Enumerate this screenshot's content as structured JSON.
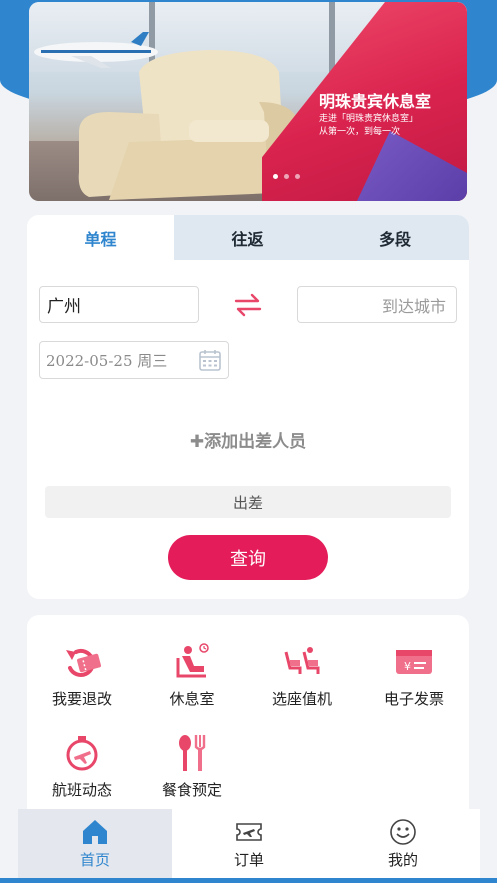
{
  "banner": {
    "title": "明珠贵宾休息室",
    "subtitle_line1": "走进「明珠贵宾休息室」",
    "subtitle_line2": "从第一次，到每一次"
  },
  "booking": {
    "tabs": [
      {
        "label": "单程",
        "active": true
      },
      {
        "label": "往返",
        "active": false
      },
      {
        "label": "多段",
        "active": false
      }
    ],
    "from_city": "广州",
    "to_city_placeholder": "到达城市",
    "date": "2022-05-25 周三",
    "add_traveler": "添加出差人员",
    "trip_type": "出差",
    "search_label": "查询"
  },
  "services": [
    {
      "label": "我要退改",
      "icon": "refund-change-icon"
    },
    {
      "label": "休息室",
      "icon": "lounge-icon"
    },
    {
      "label": "选座值机",
      "icon": "seat-checkin-icon"
    },
    {
      "label": "电子发票",
      "icon": "e-invoice-icon"
    },
    {
      "label": "航班动态",
      "icon": "flight-status-icon"
    },
    {
      "label": "餐食预定",
      "icon": "meal-booking-icon"
    }
  ],
  "tabbar": [
    {
      "label": "首页",
      "icon": "home-icon",
      "active": true
    },
    {
      "label": "订单",
      "icon": "order-ticket-icon",
      "active": false
    },
    {
      "label": "我的",
      "icon": "smiley-profile-icon",
      "active": false
    }
  ],
  "colors": {
    "brand_blue": "#2f86cf",
    "accent_red": "#e41d5a",
    "icon_pink": "#e8476a"
  }
}
